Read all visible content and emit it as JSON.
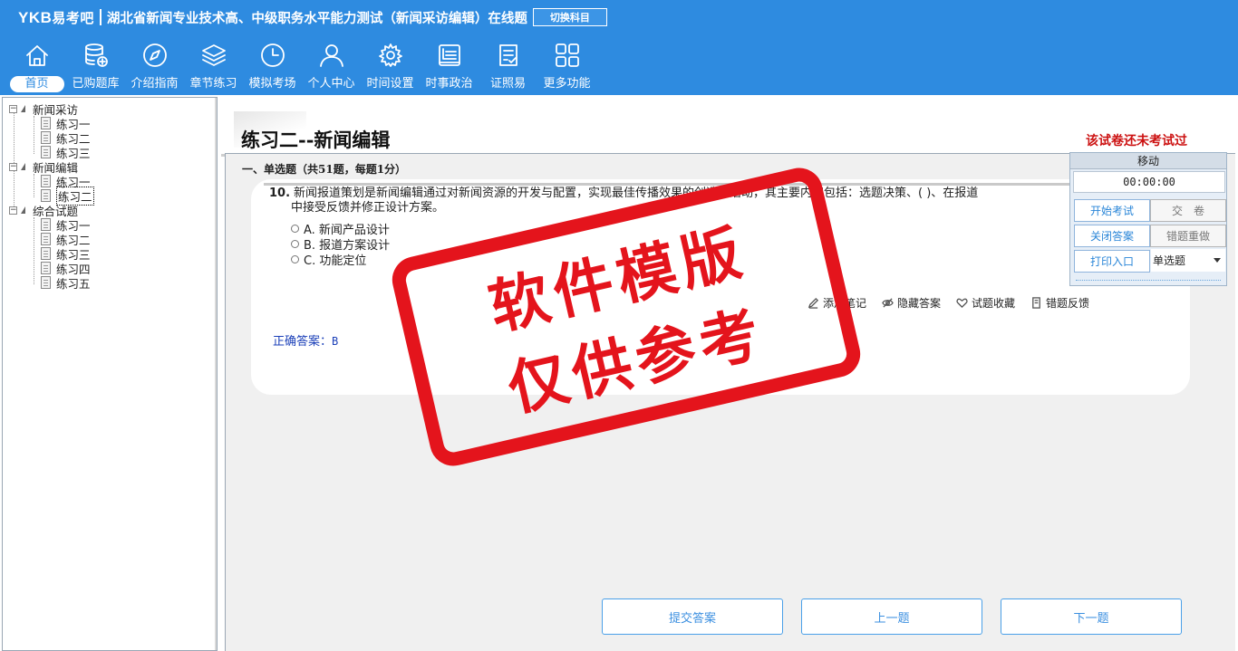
{
  "header": {
    "logo_latin": "YKB",
    "logo_cn": "易考吧",
    "app_title": "湖北省新闻专业技术高、中级职务水平能力测试（新闻采访编辑）在线题",
    "switch_label": "切换科目",
    "toolbar": [
      {
        "label": "首页",
        "icon": "home-icon",
        "active": true
      },
      {
        "label": "已购题库",
        "icon": "database-icon"
      },
      {
        "label": "介绍指南",
        "icon": "compass-icon"
      },
      {
        "label": "章节练习",
        "icon": "layers-icon"
      },
      {
        "label": "模拟考场",
        "icon": "clock-icon"
      },
      {
        "label": "个人中心",
        "icon": "user-icon"
      },
      {
        "label": "时间设置",
        "icon": "gear-icon"
      },
      {
        "label": "时事政治",
        "icon": "news-icon"
      },
      {
        "label": "证照易",
        "icon": "checklist-icon"
      },
      {
        "label": "更多功能",
        "icon": "grid-icon"
      }
    ]
  },
  "tree": {
    "groups": [
      {
        "label": "新闻采访",
        "items": [
          "练习一",
          "练习二",
          "练习三"
        ]
      },
      {
        "label": "新闻编辑",
        "items": [
          "练习一",
          "练习二"
        ]
      },
      {
        "label": "综合试题",
        "items": [
          "练习一",
          "练习二",
          "练习三",
          "练习四",
          "练习五"
        ]
      }
    ],
    "expand_symbol": "−"
  },
  "paper": {
    "title": "练习二--新闻编辑",
    "status": "该试卷还未考试过",
    "section": "一、单选题（共51题，每题1分）"
  },
  "question": {
    "number": "10.",
    "stem_line1": "新闻报道策划是新闻编辑通过对新闻资源的开发与配置，实现最佳传播效果的创造性活动，其主要内容包括：选题决策、( )、在报道",
    "stem_line2": "中接受反馈并修正设计方案。",
    "options": [
      "A. 新闻产品设计",
      "B. 报道方案设计",
      "C. 功能定位"
    ],
    "actions": [
      "添加笔记",
      "隐藏答案",
      "试题收藏",
      "错题反馈"
    ],
    "answer_label": "正确答案：",
    "answer_value": "B"
  },
  "nav": {
    "submit": "提交答案",
    "prev": "上一题",
    "next": "下一题"
  },
  "exam_panel": {
    "move_label": "移动",
    "timer": "00:00:00",
    "start": "开始考试",
    "hand_in": "交　卷",
    "close_answer": "关闭答案",
    "redo_wrong": "错题重做",
    "print": "打印入口",
    "type_select": "单选题"
  },
  "watermark": {
    "line1": "软件模版",
    "line2": "仅供参考"
  }
}
